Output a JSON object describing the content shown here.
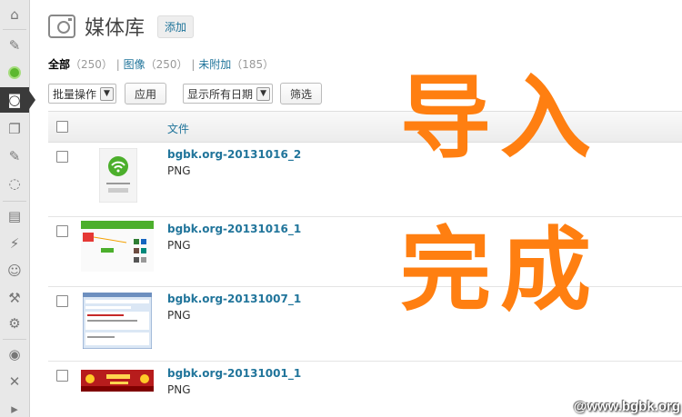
{
  "sidebar": {
    "items": [
      {
        "icon": "home-icon",
        "glyph": "⌂"
      },
      {
        "icon": "pin-icon",
        "glyph": "✎"
      },
      {
        "icon": "green-dot-icon",
        "glyph": ""
      },
      {
        "icon": "media-icon",
        "glyph": "◙"
      },
      {
        "icon": "pages-icon",
        "glyph": "❐"
      },
      {
        "icon": "pin-icon",
        "glyph": "✎"
      },
      {
        "icon": "comment-icon",
        "glyph": "◌"
      },
      {
        "icon": "appearance-icon",
        "glyph": "▤"
      },
      {
        "icon": "plugins-icon",
        "glyph": "⚡"
      },
      {
        "icon": "users-icon",
        "glyph": "☺"
      },
      {
        "icon": "tools-icon",
        "glyph": "⚒"
      },
      {
        "icon": "settings-icon",
        "glyph": "⚙"
      },
      {
        "icon": "circle-icon",
        "glyph": "◉"
      },
      {
        "icon": "tools-cross-icon",
        "glyph": "✕"
      },
      {
        "icon": "play-icon",
        "glyph": "▸"
      }
    ]
  },
  "header": {
    "title": "媒体库",
    "add_label": "添加"
  },
  "filters": {
    "all_label": "全部",
    "all_count": "（250）",
    "images_label": "图像",
    "images_count": "（250）",
    "unattached_label": "未附加",
    "unattached_count": "（185）",
    "sep": "|"
  },
  "actions": {
    "bulk_label": "批量操作",
    "apply_label": "应用",
    "date_label": "显示所有日期",
    "filter_label": "筛选"
  },
  "table": {
    "col_file": "文件",
    "rows": [
      {
        "name": "bgbk.org-20131016_2",
        "type": "PNG"
      },
      {
        "name": "bgbk.org-20131016_1",
        "type": "PNG"
      },
      {
        "name": "bgbk.org-20131007_1",
        "type": "PNG"
      },
      {
        "name": "bgbk.org-20131001_1",
        "type": "PNG"
      }
    ]
  },
  "overlay": {
    "line1": "导入",
    "line2": "完成"
  },
  "watermark": "@www.bgbk.org",
  "colors": {
    "accent_orange": "#ff7f11",
    "link_blue": "#21759b"
  }
}
